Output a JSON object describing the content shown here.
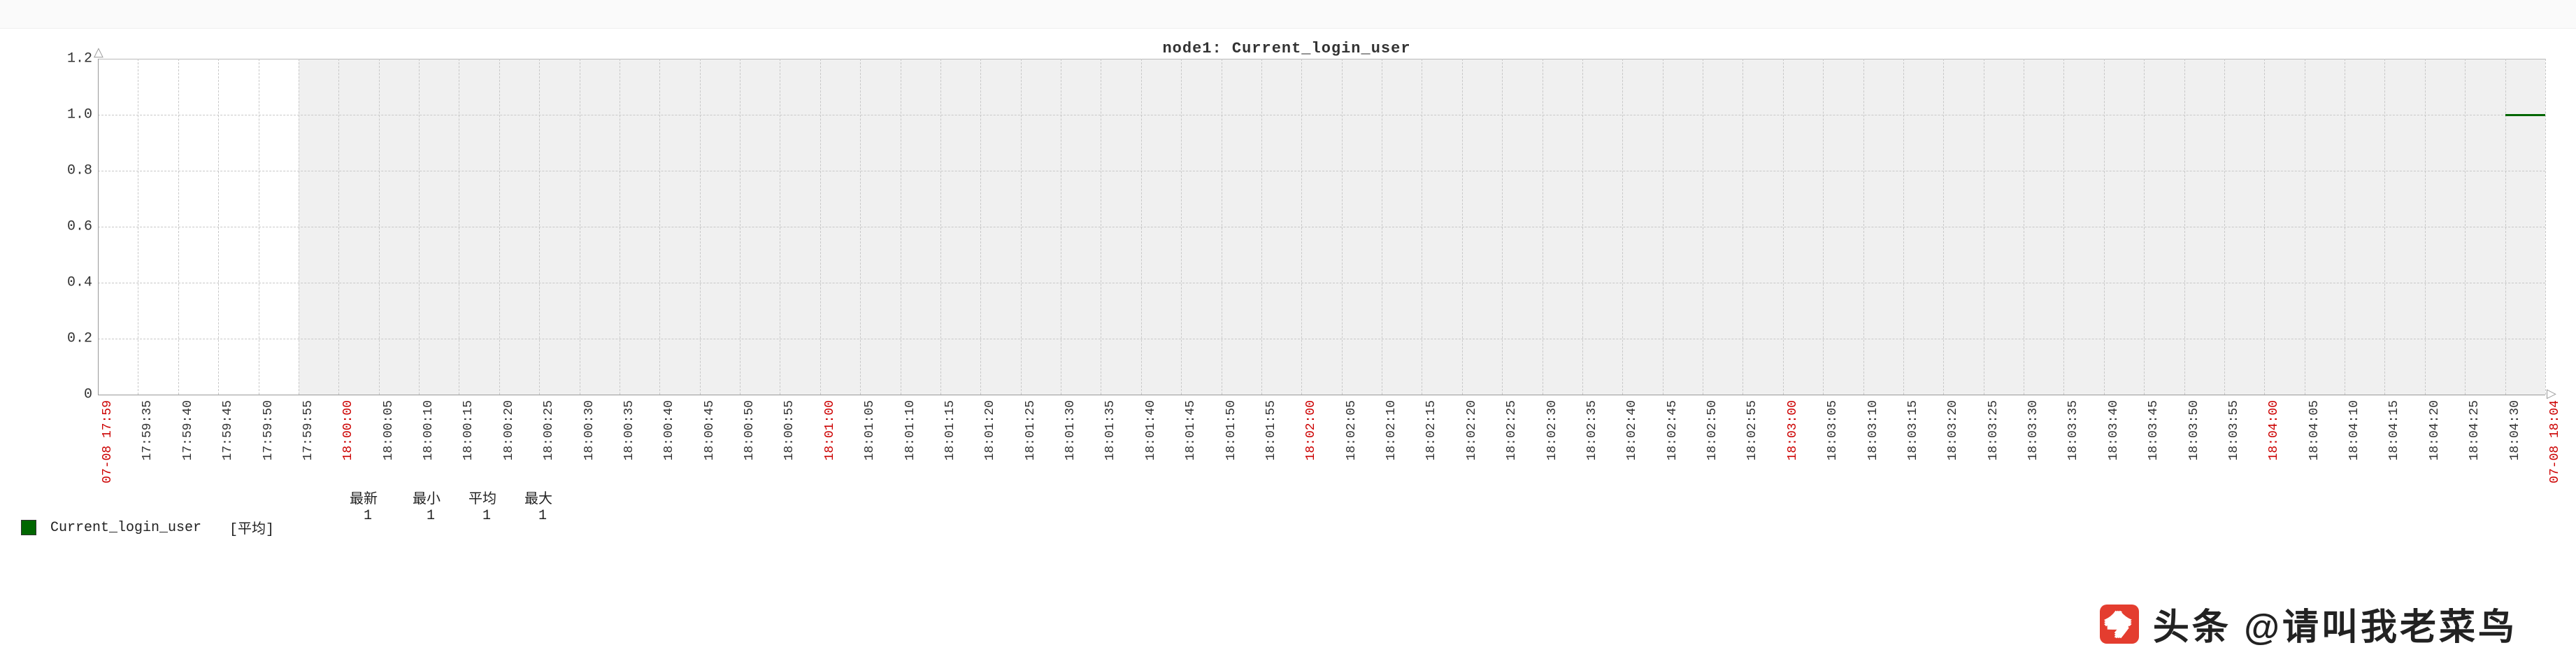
{
  "title": "node1: Current_login_user",
  "y_axis": {
    "min": 0,
    "max": 1.2,
    "ticks": [
      "0",
      "0.2",
      "0.4",
      "0.6",
      "0.8",
      "1.0",
      "1.2"
    ]
  },
  "x_axis": {
    "ticks": [
      {
        "label": "07-08 17:59",
        "red": true
      },
      {
        "label": "17:59:35"
      },
      {
        "label": "17:59:40"
      },
      {
        "label": "17:59:45"
      },
      {
        "label": "17:59:50"
      },
      {
        "label": "17:59:55"
      },
      {
        "label": "18:00:00",
        "red": true
      },
      {
        "label": "18:00:05"
      },
      {
        "label": "18:00:10"
      },
      {
        "label": "18:00:15"
      },
      {
        "label": "18:00:20"
      },
      {
        "label": "18:00:25"
      },
      {
        "label": "18:00:30"
      },
      {
        "label": "18:00:35"
      },
      {
        "label": "18:00:40"
      },
      {
        "label": "18:00:45"
      },
      {
        "label": "18:00:50"
      },
      {
        "label": "18:00:55"
      },
      {
        "label": "18:01:00",
        "red": true
      },
      {
        "label": "18:01:05"
      },
      {
        "label": "18:01:10"
      },
      {
        "label": "18:01:15"
      },
      {
        "label": "18:01:20"
      },
      {
        "label": "18:01:25"
      },
      {
        "label": "18:01:30"
      },
      {
        "label": "18:01:35"
      },
      {
        "label": "18:01:40"
      },
      {
        "label": "18:01:45"
      },
      {
        "label": "18:01:50"
      },
      {
        "label": "18:01:55"
      },
      {
        "label": "18:02:00",
        "red": true
      },
      {
        "label": "18:02:05"
      },
      {
        "label": "18:02:10"
      },
      {
        "label": "18:02:15"
      },
      {
        "label": "18:02:20"
      },
      {
        "label": "18:02:25"
      },
      {
        "label": "18:02:30"
      },
      {
        "label": "18:02:35"
      },
      {
        "label": "18:02:40"
      },
      {
        "label": "18:02:45"
      },
      {
        "label": "18:02:50"
      },
      {
        "label": "18:02:55"
      },
      {
        "label": "18:03:00",
        "red": true
      },
      {
        "label": "18:03:05"
      },
      {
        "label": "18:03:10"
      },
      {
        "label": "18:03:15"
      },
      {
        "label": "18:03:20"
      },
      {
        "label": "18:03:25"
      },
      {
        "label": "18:03:30"
      },
      {
        "label": "18:03:35"
      },
      {
        "label": "18:03:40"
      },
      {
        "label": "18:03:45"
      },
      {
        "label": "18:03:50"
      },
      {
        "label": "18:03:55"
      },
      {
        "label": "18:04:00",
        "red": true
      },
      {
        "label": "18:04:05"
      },
      {
        "label": "18:04:10"
      },
      {
        "label": "18:04:15"
      },
      {
        "label": "18:04:20"
      },
      {
        "label": "18:04:25"
      },
      {
        "label": "18:04:30"
      },
      {
        "label": "07-08 18:04",
        "red": true
      }
    ]
  },
  "shade": {
    "from_index": 5,
    "to_index": 61
  },
  "series": {
    "name": "Current_login_user",
    "color": "#006600",
    "data_start_index": 60,
    "data_end_index": 61,
    "value": 1.0
  },
  "legend": {
    "series_name": "Current_login_user",
    "agg_label": "[平均]",
    "headers": {
      "last": "最新",
      "min": "最小",
      "avg": "平均",
      "max": "最大"
    },
    "values": {
      "last": "1",
      "min": "1",
      "avg": "1",
      "max": "1"
    }
  },
  "watermark": "头条 @请叫我老菜鸟",
  "chart_data": {
    "type": "line",
    "title": "node1: Current_login_user",
    "xlabel": "",
    "ylabel": "",
    "ylim": [
      0,
      1.2
    ],
    "series": [
      {
        "name": "Current_login_user",
        "x": [
          "18:04:30",
          "07-08 18:04"
        ],
        "y": [
          1.0,
          1.0
        ]
      }
    ],
    "note": "No data before 18:04:30; shaded no-data region from 17:59:55 to end. Stats: last=1 min=1 avg=1 max=1."
  }
}
